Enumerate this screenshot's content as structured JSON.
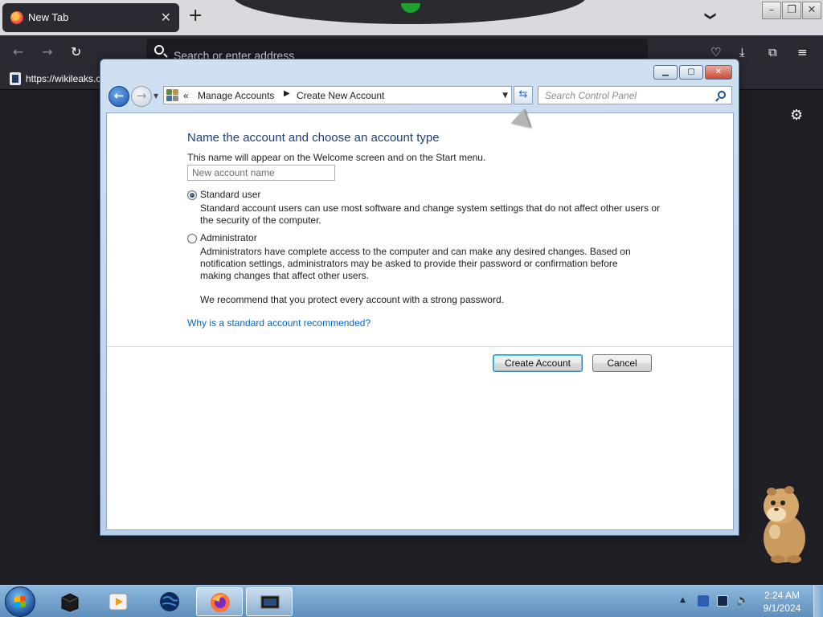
{
  "browser": {
    "tab_title": "New Tab",
    "tab_close": "✕",
    "new_tab": "+",
    "tab_list": "❯",
    "address_placeholder": "Search or enter address",
    "bookmark": "https://wikileaks.c"
  },
  "window": {
    "breadcrumb": [
      "Manage Accounts",
      "Create New Account"
    ],
    "breadcrumb_prefix": "«",
    "search_placeholder": "Search Control Panel"
  },
  "form": {
    "heading": "Name the account and choose an account type",
    "note": "This name will appear on the Welcome screen and on the Start menu.",
    "name_placeholder": "New account name",
    "standard_label": "Standard user",
    "standard_desc": "Standard account users can use most software and change system settings that do not affect other users or the security of the computer.",
    "admin_label": "Administrator",
    "admin_desc": "Administrators have complete access to the computer and can make any desired changes. Based on notification settings, administrators may be asked to provide their password or confirmation before making changes that affect other users.",
    "recommend": "We recommend that you protect every account with a strong password.",
    "why_link": "Why is a standard account recommended?",
    "create_button": "Create Account",
    "cancel_button": "Cancel",
    "selected_type": "Standard user"
  },
  "taskbar": {
    "time": "2:24 AM",
    "date": "9/1/2024"
  },
  "colors": {
    "heading": "#1e3f7a",
    "link": "#0066cc",
    "firefox_dark": "#2b2a33"
  }
}
